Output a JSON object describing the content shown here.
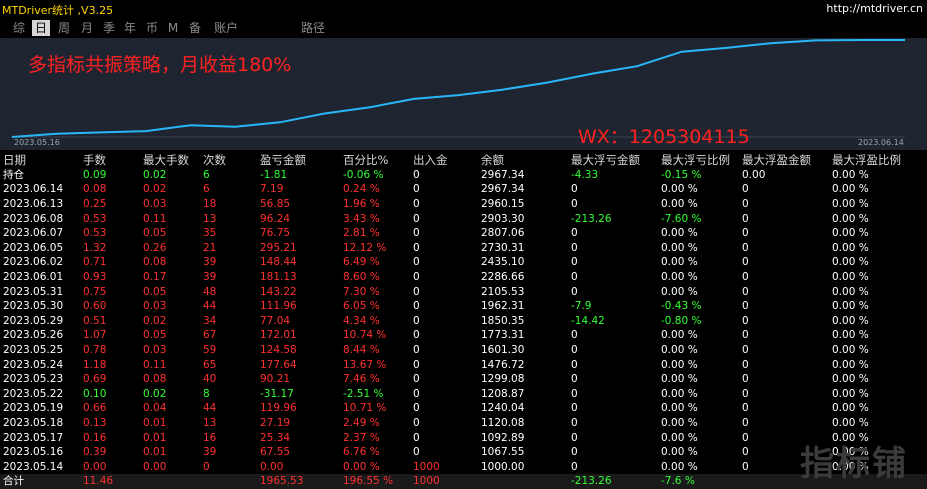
{
  "window": {
    "title": "MTDriver统计 ,V3.25",
    "url": "http://mtdriver.cn"
  },
  "tabs": [
    "综",
    "日",
    "周",
    "月",
    "季",
    "年",
    "币",
    "M",
    "备",
    "账户",
    "路径"
  ],
  "active_tab": "日",
  "chart": {
    "title": "多指标共振策略，月收益180%",
    "start_label": "2023.05.16",
    "end_label": "2023.06.14",
    "line_color": "#29b6f6",
    "background": "#1f2530"
  },
  "chart_data": {
    "type": "line",
    "x_start": "2023.05.16",
    "x_end": "2023.06.14",
    "values": [
      1000.0,
      1067.55,
      1092.89,
      1120.08,
      1240.04,
      1208.87,
      1299.08,
      1476.72,
      1601.3,
      1773.31,
      1850.35,
      1962.31,
      2105.53,
      2286.66,
      2435.1,
      2730.31,
      2807.06,
      2903.3,
      2960.15,
      2967.34,
      2967.34
    ]
  },
  "watermark_wx": "WX：1205304115",
  "corner_watermark": "指标铺",
  "headers": [
    "日期",
    "手数",
    "最大手数",
    "次数",
    "盈亏金额",
    "百分比%",
    "出入金",
    "余额",
    "最大浮亏金额",
    "最大浮亏比例",
    "最大浮盈金额",
    "最大浮盈比例"
  ],
  "rows": [
    [
      "持仓",
      "0.09",
      "0.02",
      "6",
      "-1.81",
      "-0.06 %",
      "0",
      "2967.34",
      "-4.33",
      "-0.15 %",
      "0.00",
      "0.00 %"
    ],
    [
      "2023.06.14",
      "0.08",
      "0.02",
      "6",
      "7.19",
      "0.24 %",
      "0",
      "2967.34",
      "0",
      "0.00 %",
      "0",
      "0.00 %"
    ],
    [
      "2023.06.13",
      "0.25",
      "0.03",
      "18",
      "56.85",
      "1.96 %",
      "0",
      "2960.15",
      "0",
      "0.00 %",
      "0",
      "0.00 %"
    ],
    [
      "2023.06.08",
      "0.53",
      "0.11",
      "13",
      "96.24",
      "3.43 %",
      "0",
      "2903.30",
      "-213.26",
      "-7.60 %",
      "0",
      "0.00 %"
    ],
    [
      "2023.06.07",
      "0.53",
      "0.05",
      "35",
      "76.75",
      "2.81 %",
      "0",
      "2807.06",
      "0",
      "0.00 %",
      "0",
      "0.00 %"
    ],
    [
      "2023.06.05",
      "1.32",
      "0.26",
      "21",
      "295.21",
      "12.12 %",
      "0",
      "2730.31",
      "0",
      "0.00 %",
      "0",
      "0.00 %"
    ],
    [
      "2023.06.02",
      "0.71",
      "0.08",
      "39",
      "148.44",
      "6.49 %",
      "0",
      "2435.10",
      "0",
      "0.00 %",
      "0",
      "0.00 %"
    ],
    [
      "2023.06.01",
      "0.93",
      "0.17",
      "39",
      "181.13",
      "8.60 %",
      "0",
      "2286.66",
      "0",
      "0.00 %",
      "0",
      "0.00 %"
    ],
    [
      "2023.05.31",
      "0.75",
      "0.05",
      "48",
      "143.22",
      "7.30 %",
      "0",
      "2105.53",
      "0",
      "0.00 %",
      "0",
      "0.00 %"
    ],
    [
      "2023.05.30",
      "0.60",
      "0.03",
      "44",
      "111.96",
      "6.05 %",
      "0",
      "1962.31",
      "-7.9",
      "-0.43 %",
      "0",
      "0.00 %"
    ],
    [
      "2023.05.29",
      "0.51",
      "0.02",
      "34",
      "77.04",
      "4.34 %",
      "0",
      "1850.35",
      "-14.42",
      "-0.80 %",
      "0",
      "0.00 %"
    ],
    [
      "2023.05.26",
      "1.07",
      "0.05",
      "67",
      "172.01",
      "10.74 %",
      "0",
      "1773.31",
      "0",
      "0.00 %",
      "0",
      "0.00 %"
    ],
    [
      "2023.05.25",
      "0.78",
      "0.03",
      "59",
      "124.58",
      "8.44 %",
      "0",
      "1601.30",
      "0",
      "0.00 %",
      "0",
      "0.00 %"
    ],
    [
      "2023.05.24",
      "1.18",
      "0.11",
      "65",
      "177.64",
      "13.67 %",
      "0",
      "1476.72",
      "0",
      "0.00 %",
      "0",
      "0.00 %"
    ],
    [
      "2023.05.23",
      "0.69",
      "0.08",
      "40",
      "90.21",
      "7.46 %",
      "0",
      "1299.08",
      "0",
      "0.00 %",
      "0",
      "0.00 %"
    ],
    [
      "2023.05.22",
      "0.10",
      "0.02",
      "8",
      "-31.17",
      "-2.51 %",
      "0",
      "1208.87",
      "0",
      "0.00 %",
      "0",
      "0.00 %"
    ],
    [
      "2023.05.19",
      "0.66",
      "0.04",
      "44",
      "119.96",
      "10.71 %",
      "0",
      "1240.04",
      "0",
      "0.00 %",
      "0",
      "0.00 %"
    ],
    [
      "2023.05.18",
      "0.13",
      "0.01",
      "13",
      "27.19",
      "2.49 %",
      "0",
      "1120.08",
      "0",
      "0.00 %",
      "0",
      "0.00 %"
    ],
    [
      "2023.05.17",
      "0.16",
      "0.01",
      "16",
      "25.34",
      "2.37 %",
      "0",
      "1092.89",
      "0",
      "0.00 %",
      "0",
      "0.00 %"
    ],
    [
      "2023.05.16",
      "0.39",
      "0.01",
      "39",
      "67.55",
      "6.76 %",
      "0",
      "1067.55",
      "0",
      "0.00 %",
      "0",
      "0.00 %"
    ],
    [
      "2023.05.14",
      "0.00",
      "0.00",
      "0",
      "0.00",
      "0.00 %",
      "1000",
      "1000.00",
      "0",
      "0.00 %",
      "0",
      "0.00 %"
    ]
  ],
  "total": [
    "合计",
    "11.46",
    "",
    "",
    "1965.53",
    "196.55 %",
    "1000",
    "",
    "-213.26",
    "-7.6 %",
    "",
    ""
  ]
}
